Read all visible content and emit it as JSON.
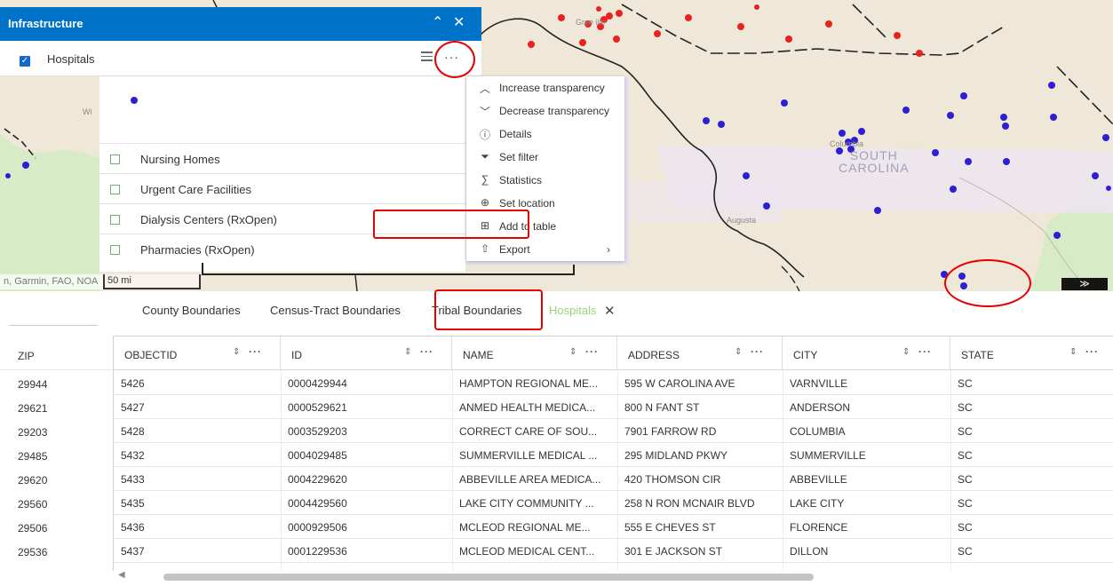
{
  "panel": {
    "title": "Infrastructure",
    "collapse_icon": "double-chevron-up-icon",
    "close_icon": "close-icon",
    "layer": {
      "label": "Hospitals",
      "checked": true
    },
    "sublayers": [
      {
        "label": "Nursing Homes",
        "checked": false
      },
      {
        "label": "Urgent Care Facilities",
        "checked": false
      },
      {
        "label": "Dialysis Centers (RxOpen)",
        "checked": false
      },
      {
        "label": "Pharmacies (RxOpen)",
        "checked": false
      }
    ],
    "more_label": "···"
  },
  "context_menu": {
    "items": [
      {
        "label": "Increase transparency",
        "icon": "chevron-up-icon"
      },
      {
        "label": "Decrease transparency",
        "icon": "chevron-down-icon"
      },
      {
        "label": "Details",
        "icon": "info-icon"
      },
      {
        "label": "Set filter",
        "icon": "filter-icon"
      },
      {
        "label": "Statistics",
        "icon": "sigma-icon"
      },
      {
        "label": "Set location",
        "icon": "location-icon"
      },
      {
        "label": "Add to table",
        "icon": "add-table-icon"
      },
      {
        "label": "Export",
        "icon": "export-icon"
      }
    ]
  },
  "map": {
    "state_label_line1": "SOUTH",
    "state_label_line2": "CAROLINA",
    "place_augusta": "Augusta",
    "place_columbia": "Columbia",
    "place_green": "Gree ille",
    "place_wi": "Wi",
    "attribution": "n, Garmin, FAO, NOA",
    "scale": "50 mi",
    "collapse_label": "≫",
    "colors": {
      "hospital_dot": "#2d1fd4",
      "other_dot": "#e8231f",
      "land": "#efe7d8",
      "water": "#d7ecc6",
      "urban": "#ece6f0"
    }
  },
  "tabs": [
    {
      "label": "County Boundaries"
    },
    {
      "label": "Census-Tract Boundaries"
    },
    {
      "label": "Tribal Boundaries"
    },
    {
      "label": "Hospitals",
      "active": true
    }
  ],
  "tab_close": "✕",
  "table": {
    "zip_header": "ZIP",
    "zip_values": [
      "29944",
      "29621",
      "29203",
      "29485",
      "29620",
      "29560",
      "29506",
      "29536"
    ],
    "columns": [
      "OBJECTID",
      "ID",
      "NAME",
      "ADDRESS",
      "CITY",
      "STATE"
    ],
    "rows": [
      [
        "5426",
        "0000429944",
        "HAMPTON REGIONAL ME...",
        "595 W CAROLINA AVE",
        "VARNVILLE",
        "SC"
      ],
      [
        "5427",
        "0000529621",
        "ANMED HEALTH MEDICA...",
        "800 N FANT ST",
        "ANDERSON",
        "SC"
      ],
      [
        "5428",
        "0003529203",
        "CORRECT CARE OF SOU...",
        "7901 FARROW RD",
        "COLUMBIA",
        "SC"
      ],
      [
        "5432",
        "0004029485",
        "SUMMERVILLE MEDICAL ...",
        "295 MIDLAND PKWY",
        "SUMMERVILLE",
        "SC"
      ],
      [
        "5433",
        "0004229620",
        "ABBEVILLE AREA MEDICA...",
        "420 THOMSON CIR",
        "ABBEVILLE",
        "SC"
      ],
      [
        "5435",
        "0004429560",
        "LAKE CITY COMMUNITY ...",
        "258 N RON MCNAIR BLVD",
        "LAKE CITY",
        "SC"
      ],
      [
        "5436",
        "0000929506",
        "MCLEOD REGIONAL ME...",
        "555 E CHEVES ST",
        "FLORENCE",
        "SC"
      ],
      [
        "5437",
        "0001229536",
        "MCLEOD MEDICAL CENT...",
        "301 E JACKSON ST",
        "DILLON",
        "SC"
      ]
    ],
    "sort_icon": "⇕",
    "col_more": "···"
  }
}
